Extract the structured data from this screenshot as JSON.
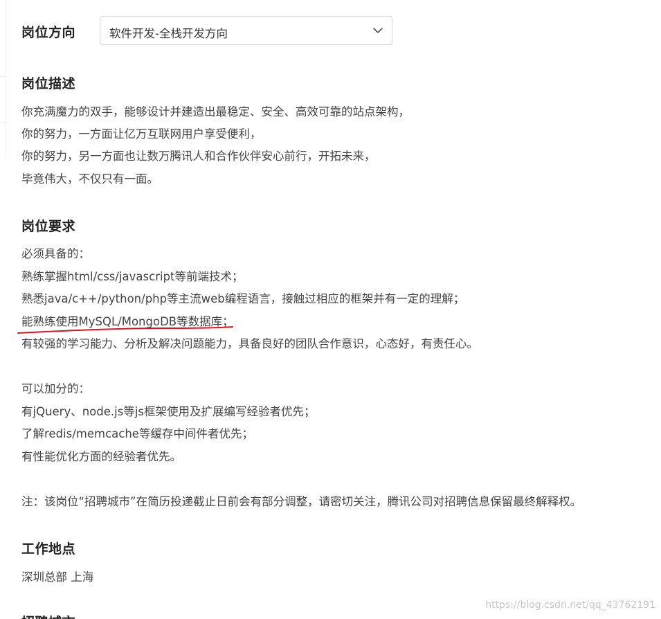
{
  "direction": {
    "label": "岗位方向",
    "selected": "软件开发-全栈开发方向",
    "chevron_icon": "chevron-down-icon"
  },
  "description": {
    "title": "岗位描述",
    "lines": [
      "你充满魔力的双手，能够设计并建造出最稳定、安全、高效可靠的站点架构，",
      "你的努力，一方面让亿万互联网用户享受便利，",
      "你的努力，另一方面也让数万腾讯人和合作伙伴安心前行，开拓未来，",
      "毕竟伟大，不仅只有一面。"
    ]
  },
  "requirements": {
    "title": "岗位要求",
    "required_heading": "必须具备的：",
    "required": [
      "熟练掌握html/css/javascript等前端技术；",
      "熟悉java/c++/python/php等主流web编程语言，接触过相应的框架并有一定的理解；",
      "能熟练使用MySQL/MongoDB等数据库；",
      "有较强的学习能力、分析及解决问题能力，具备良好的团队合作意识，心态好，有责任心。"
    ],
    "bonus_heading": "可以加分的：",
    "bonus": [
      "有jQuery、node.js等js框架使用及扩展编写经验者优先；",
      "了解redis/memcache等缓存中间件者优先；",
      "有性能优化方面的经验者优先。"
    ],
    "note": "注：该岗位“招聘城市”在简历投递截止日前会有部分调整，请密切关注，腾讯公司对招聘信息保留最终解释权。"
  },
  "location": {
    "title": "工作地点",
    "value": "深圳总部 上海"
  },
  "next_section": {
    "title": "招聘城市"
  },
  "watermark": "https://blog.csdn.net/qq_43762191",
  "colors": {
    "annotation_underline": "#e0141e"
  }
}
